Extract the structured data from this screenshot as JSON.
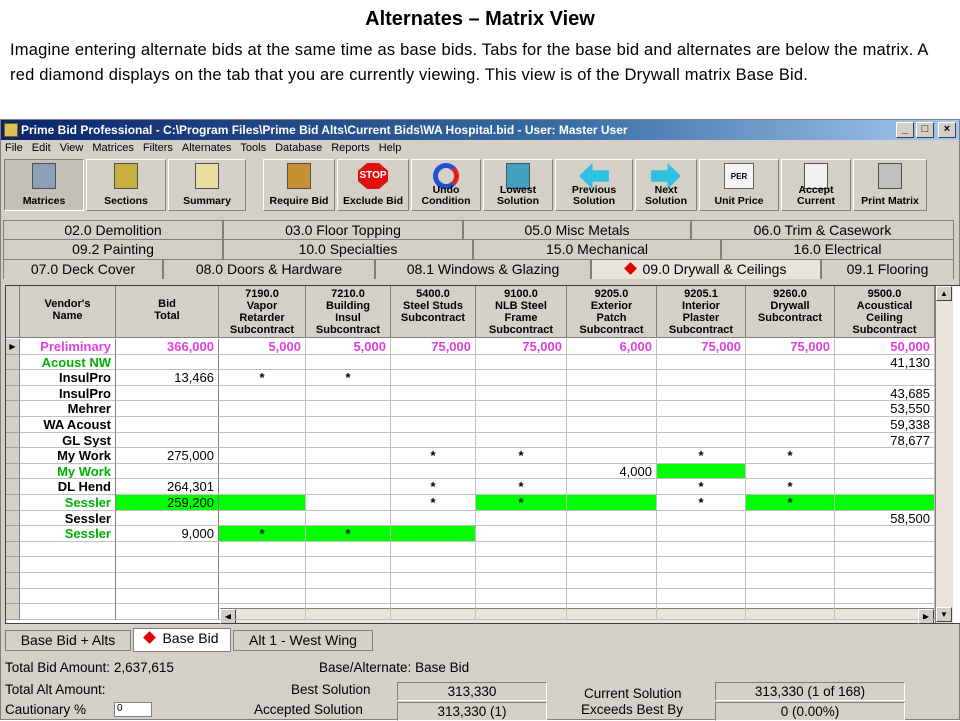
{
  "slide": {
    "title": "Alternates – Matrix View",
    "description": "Imagine entering alternate bids at the same time as base bids. Tabs for the base bid and alternates are below the matrix. A red diamond displays on the tab that you are currently viewing. This view is of the Drywall matrix Base Bid."
  },
  "window": {
    "title": "Prime Bid Professional - C:\\Program Files\\Prime Bid Alts\\Current Bids\\WA Hospital.bid - User: Master User",
    "controls": [
      "_",
      "□",
      "×"
    ]
  },
  "menu": [
    "File",
    "Edit",
    "View",
    "Matrices",
    "Filters",
    "Alternates",
    "Tools",
    "Database",
    "Reports",
    "Help"
  ],
  "toolbar": [
    {
      "id": "matrices",
      "label": "Matrices",
      "icon": "matrices-icon"
    },
    {
      "id": "sections",
      "label": "Sections",
      "icon": "sections-icon"
    },
    {
      "id": "summary",
      "label": "Summary",
      "icon": "summary-icon"
    },
    {
      "id": "require-bid",
      "label": "Require Bid",
      "icon": "require-bid-icon"
    },
    {
      "id": "exclude-bid",
      "label": "Exclude Bid",
      "icon": "stop-sign-icon",
      "icon_text": "STOP"
    },
    {
      "id": "undo-condition",
      "label": "Undo\nCondition",
      "icon": "undo-icon"
    },
    {
      "id": "lowest-solution",
      "label": "Lowest\nSolution",
      "icon": "lowest-solution-icon"
    },
    {
      "id": "previous-solution",
      "label": "Previous\nSolution",
      "icon": "left-arrow-icon"
    },
    {
      "id": "next-solution",
      "label": "Next\nSolution",
      "icon": "right-arrow-icon"
    },
    {
      "id": "unit-price",
      "label": "Unit Price",
      "icon": "unit-price-icon",
      "icon_text": "PER"
    },
    {
      "id": "accept-current",
      "label": "Accept\nCurrent",
      "icon": "accept-current-icon"
    },
    {
      "id": "print-matrix",
      "label": "Print Matrix",
      "icon": "printer-icon"
    }
  ],
  "section_tabs": {
    "row1": [
      "02.0 Demolition",
      "03.0 Floor Topping",
      "05.0 Misc Metals",
      "06.0 Trim & Casework"
    ],
    "row2": [
      "09.2 Painting",
      "10.0 Specialties",
      "15.0 Mechanical",
      "16.0 Electrical"
    ],
    "row3": [
      "07.0 Deck Cover",
      "08.0 Doors & Hardware",
      "08.1 Windows & Glazing",
      "09.0 Drywall & Ceilings",
      "09.1 Flooring"
    ],
    "active": "09.0 Drywall & Ceilings"
  },
  "grid": {
    "columns": [
      "Vendor's\nName",
      "Bid\nTotal",
      "7190.0\nVapor\nRetarder\nSubcontract",
      "7210.0\nBuilding\nInsul\nSubcontract",
      "5400.0\nSteel Studs\nSubcontract",
      "9100.0\nNLB Steel\nFrame\nSubcontract",
      "9205.0\nExterior\nPatch\nSubcontract",
      "9205.1\nInterior\nPlaster\nSubcontract",
      "9260.0\nDrywall\nSubcontract",
      "9500.0\nAcoustical\nCeiling\nSubcontract"
    ],
    "rows": [
      {
        "name": "Preliminary",
        "style": "pink",
        "current": true,
        "cells": [
          "366,000",
          "5,000",
          "5,000",
          "75,000",
          "75,000",
          "6,000",
          "75,000",
          "75,000",
          "50,000"
        ],
        "green": []
      },
      {
        "name": "Acoust NW",
        "style": "green-text",
        "cells": [
          "",
          "",
          "",
          "",
          "",
          "",
          "",
          "",
          "41,130"
        ],
        "green": [
          9
        ]
      },
      {
        "name": "InsulPro",
        "cells": [
          "13,466",
          "*",
          "*",
          "",
          "",
          "",
          "",
          "",
          ""
        ],
        "green": []
      },
      {
        "name": "InsulPro",
        "cells": [
          "",
          "",
          "",
          "",
          "",
          "",
          "",
          "",
          "43,685"
        ],
        "green": []
      },
      {
        "name": "Mehrer",
        "cells": [
          "",
          "",
          "",
          "",
          "",
          "",
          "",
          "",
          "53,550"
        ],
        "green": []
      },
      {
        "name": "WA Acoust",
        "cells": [
          "",
          "",
          "",
          "",
          "",
          "",
          "",
          "",
          "59,338"
        ],
        "green": []
      },
      {
        "name": "GL Syst",
        "cells": [
          "",
          "",
          "",
          "",
          "",
          "",
          "",
          "",
          "78,677"
        ],
        "green": []
      },
      {
        "name": "My Work",
        "cells": [
          "275,000",
          "",
          "",
          "*",
          "*",
          "",
          "*",
          "*",
          ""
        ],
        "green": []
      },
      {
        "name": "My Work",
        "style": "green-text",
        "cells": [
          "",
          "",
          "",
          "",
          "",
          "4,000",
          "",
          "",
          ""
        ],
        "green": [
          6
        ]
      },
      {
        "name": "DL Hend",
        "cells": [
          "264,301",
          "",
          "",
          "*",
          "*",
          "",
          "*",
          "*",
          ""
        ],
        "green": []
      },
      {
        "name": "Sessler",
        "style": "green-text",
        "cells": [
          "259,200",
          "",
          "",
          "*",
          "*",
          "",
          "*",
          "*",
          ""
        ],
        "green": [
          0,
          1,
          4,
          5,
          7,
          8
        ]
      },
      {
        "name": "Sessler",
        "cells": [
          "",
          "",
          "",
          "",
          "",
          "",
          "",
          "",
          "58,500"
        ],
        "green": []
      },
      {
        "name": "Sessler",
        "style": "green-text",
        "cells": [
          "9,000",
          "*",
          "*",
          "",
          "",
          "",
          "",
          "",
          ""
        ],
        "green": [
          1,
          2,
          3
        ]
      }
    ],
    "empty_rows": 5
  },
  "bottom_tabs": [
    {
      "label": "Base Bid + Alts",
      "active": false
    },
    {
      "label": "Base Bid",
      "active": true,
      "diamond": true
    },
    {
      "label": "Alt 1 - West Wing",
      "active": false
    }
  ],
  "status": {
    "total_bid_label": "Total Bid Amount:",
    "total_bid_value": "2,637,615",
    "base_alt_label": "Base/Alternate:",
    "base_alt_value": "Base Bid",
    "total_alt_label": "Total Alt Amount:",
    "cautionary_label": "Cautionary %",
    "cautionary_value": "0",
    "best_solution_label": "Best Solution",
    "best_solution_value": "313,330",
    "accepted_solution_label": "Accepted Solution",
    "accepted_solution_value": "313,330 (1)",
    "current_solution_label": "Current Solution",
    "current_solution_value": "313,330 (1 of 168)",
    "exceeds_best_label": "Exceeds Best By",
    "exceeds_best_value": "0 (0.00%)"
  }
}
